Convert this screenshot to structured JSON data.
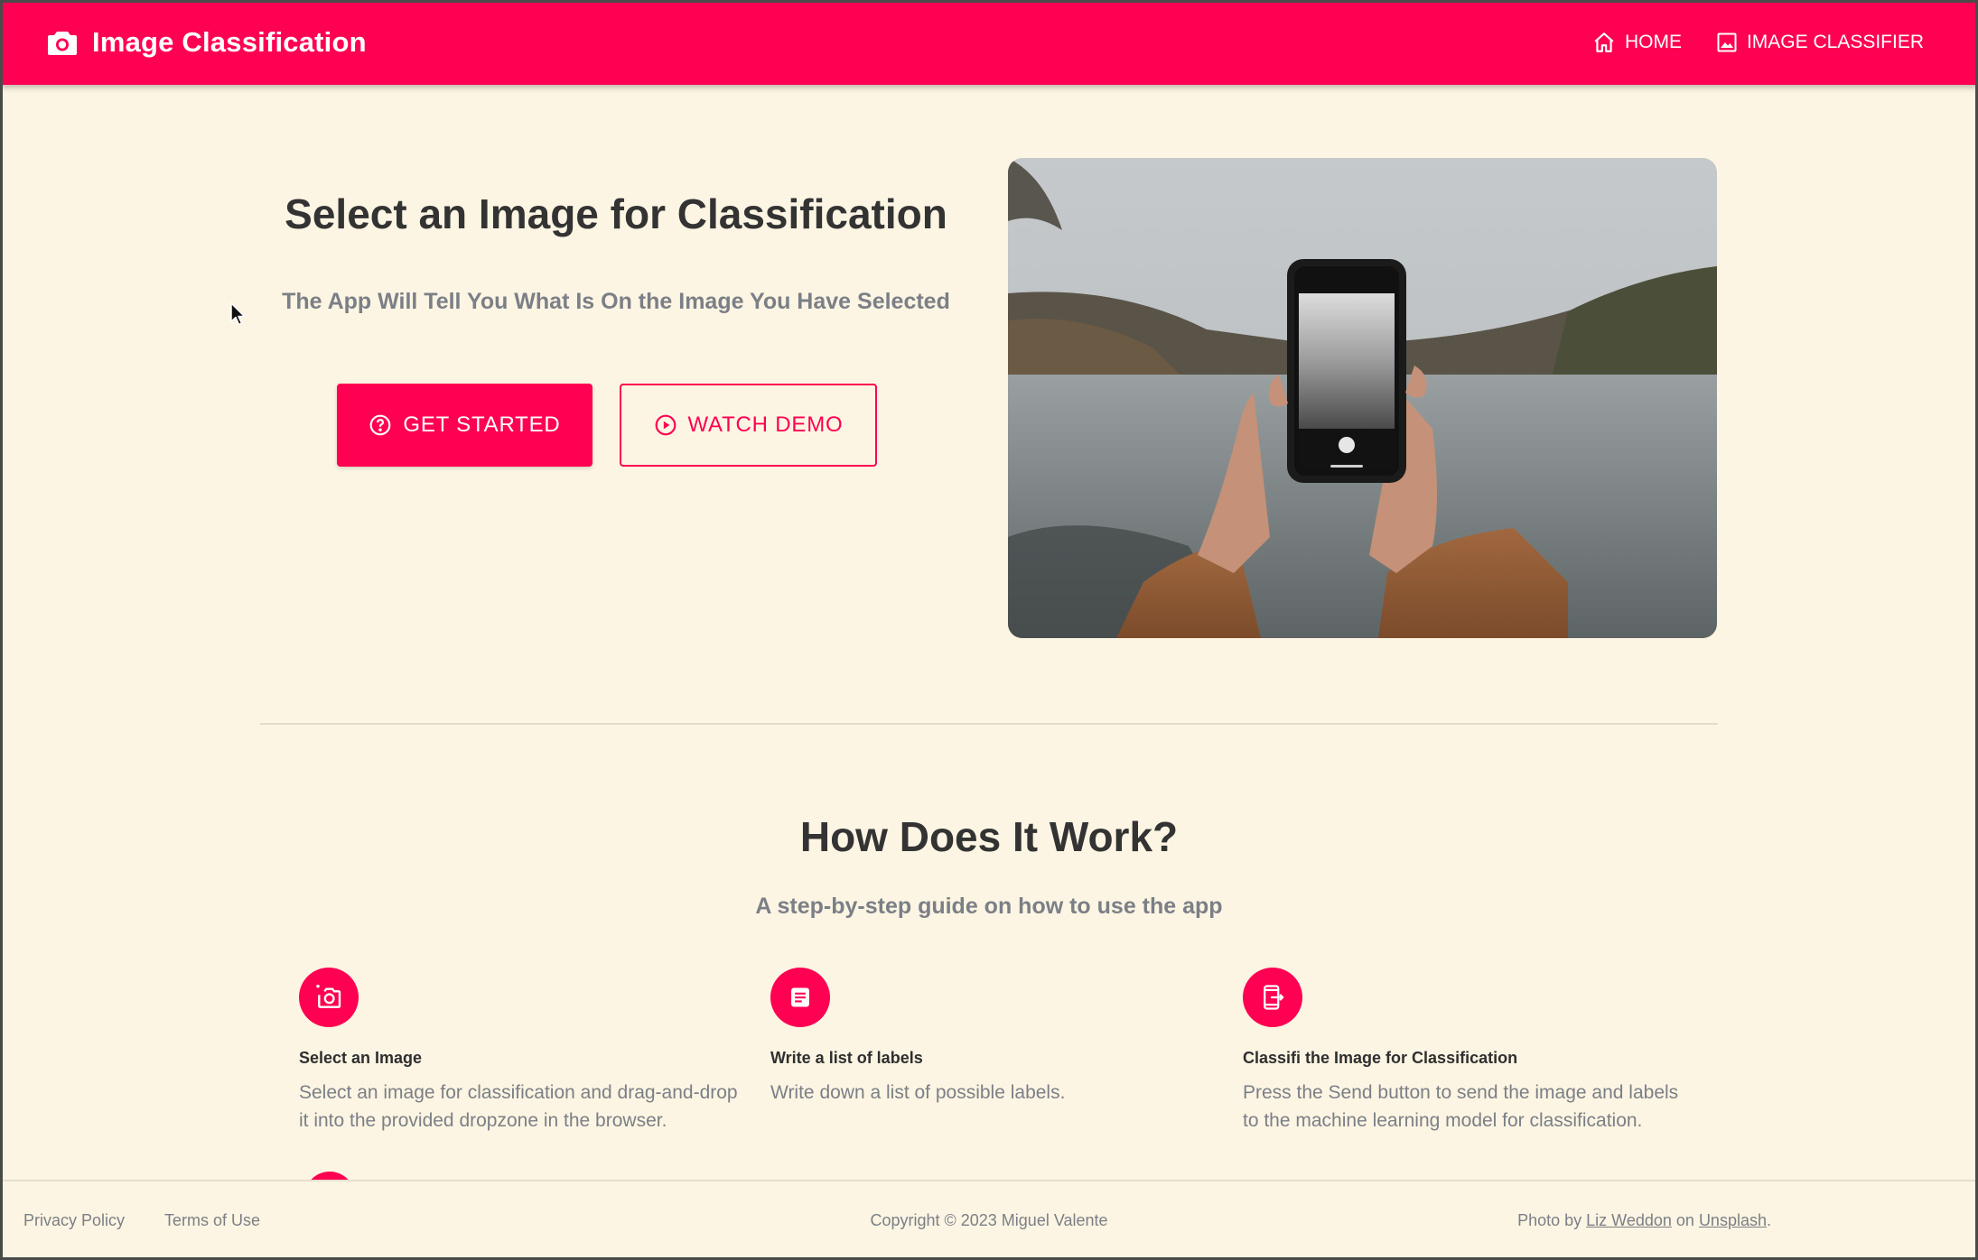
{
  "header": {
    "title": "Image Classification",
    "icon": "camera-icon",
    "nav": [
      {
        "label": "HOME",
        "icon": "home-icon"
      },
      {
        "label": "IMAGE CLASSIFIER",
        "icon": "image-icon"
      }
    ]
  },
  "hero": {
    "title": "Select an Image for Classification",
    "subtitle": "The App Will Tell You What Is On the Image You Have Selected",
    "primary_button": {
      "label": "GET STARTED",
      "icon": "help-circle-icon"
    },
    "secondary_button": {
      "label": "WATCH DEMO",
      "icon": "play-circle-icon"
    }
  },
  "how": {
    "title": "How Does It Work?",
    "subtitle": "A step-by-step guide on how to use the app",
    "steps": [
      {
        "icon": "add-photo-icon",
        "title": "Select an Image",
        "desc": "Select an image for classification and drag-and-drop it into the provided dropzone in the browser."
      },
      {
        "icon": "document-icon",
        "title": "Write a list of labels",
        "desc": "Write down a list of possible labels."
      },
      {
        "icon": "phone-send-icon",
        "title": "Classifi the Image for Classification",
        "desc": "Press the Send button to send the image and labels to the machine learning model for classification."
      }
    ]
  },
  "footer": {
    "links": [
      "Privacy Policy",
      "Terms of Use"
    ],
    "copyright": "Copyright © 2023 Miguel Valente",
    "credit_prefix": "Photo by",
    "credit_author": "Liz Weddon",
    "credit_on": "on",
    "credit_site": "Unsplash",
    "credit_suffix": "."
  },
  "colors": {
    "accent": "#ff0052",
    "background": "#fdf5e3",
    "text": "#333333",
    "muted": "#7b7f86"
  }
}
